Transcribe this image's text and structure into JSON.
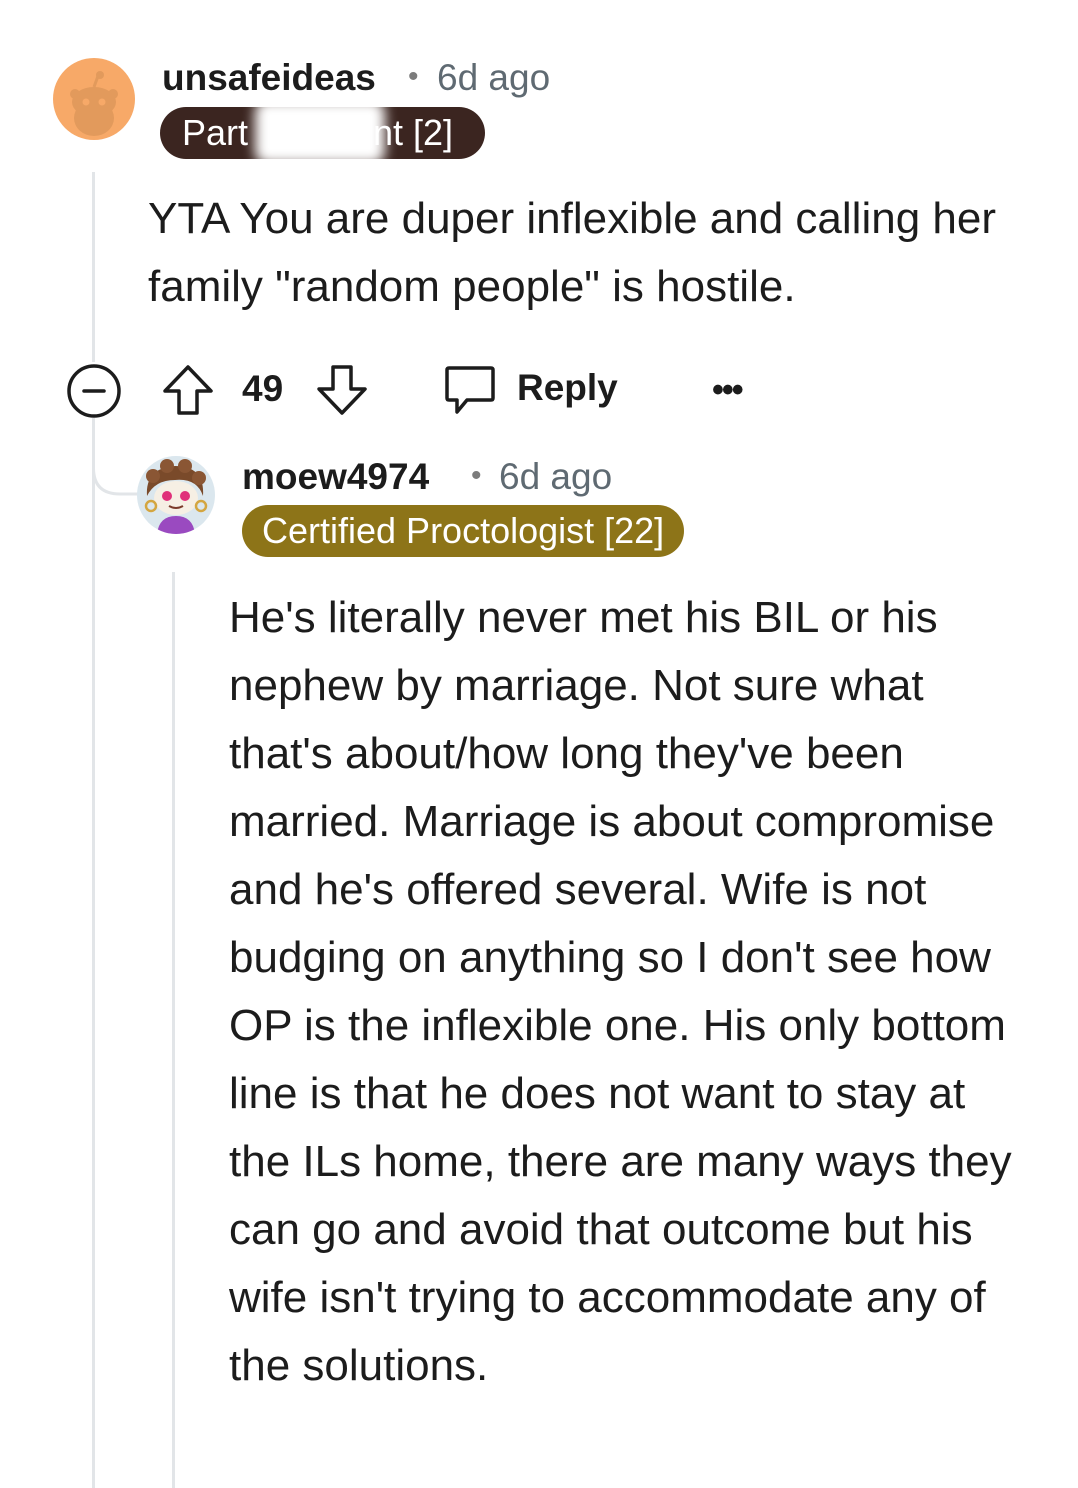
{
  "comment1": {
    "username": "unsafeideas",
    "separator": "•",
    "time": "6d ago",
    "flair_visible_left": "Part",
    "flair_visible_right": "nt [2]",
    "flair_color": "#3b2520",
    "body": "YTA You are duper inflexible and calling her family \"random people\" is hostile.",
    "actions": {
      "collapse_icon": "collapse-icon",
      "upvote_icon": "upvote-arrow-icon",
      "votes": "49",
      "downvote_icon": "downvote-arrow-icon",
      "reply_icon": "speech-bubble-icon",
      "reply_label": "Reply",
      "more_label": "•••"
    }
  },
  "comment2": {
    "username": "moew4974",
    "separator": "•",
    "time": "6d ago",
    "flair": "Certified Proctologist [22]",
    "flair_color": "#8d7418",
    "body": "He's literally never met his BIL or his nephew by marriage. Not sure what that's about/how long they've been married. Marriage is about compromise and he's offered several. Wife is not budging on anything so I don't see how OP is the inflexible one. His only bottom line is that he does not want to stay at the ILs home, there are many ways they can go and avoid that outcome but his wife isn't trying to accommodate any of the solutions."
  }
}
